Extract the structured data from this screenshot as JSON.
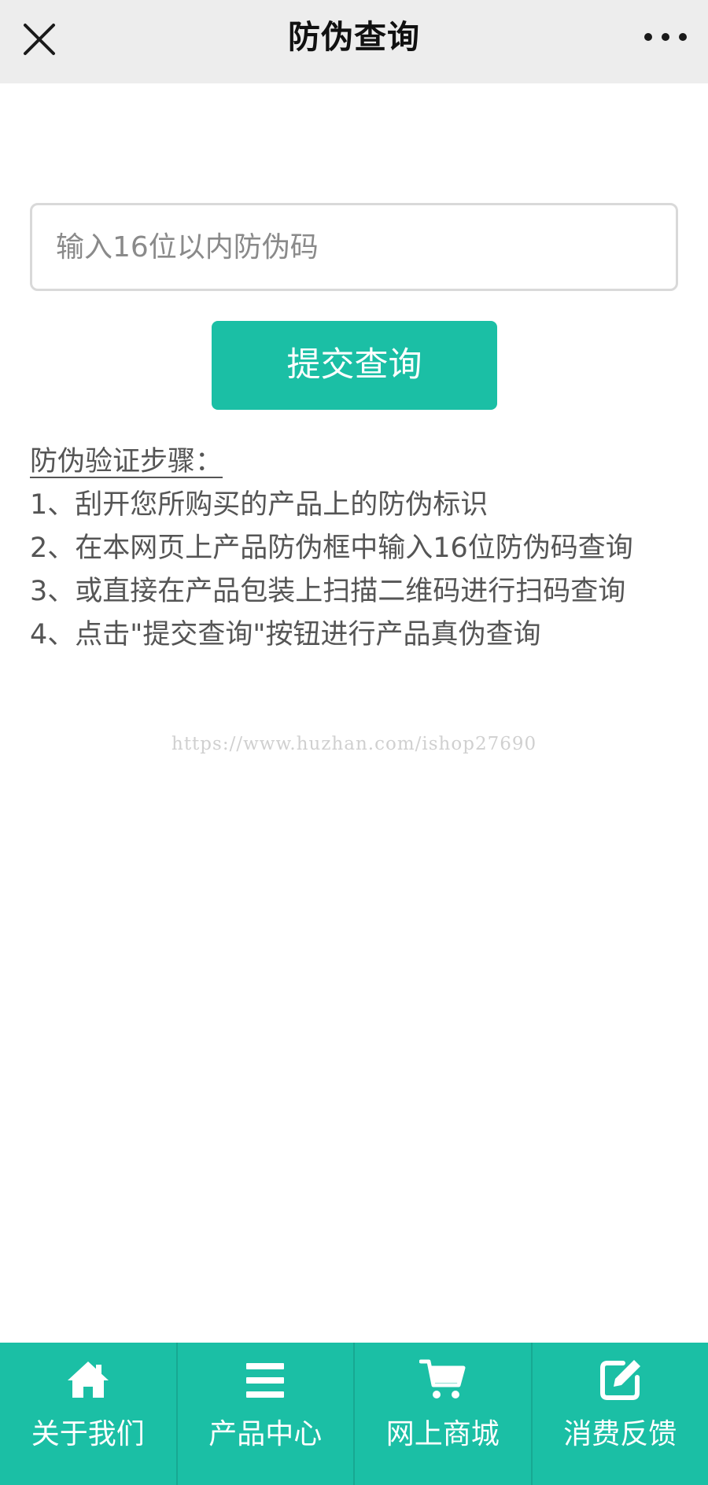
{
  "header": {
    "title": "防伪查询",
    "close_icon": "close-icon",
    "more_icon": "more-horizontal-icon"
  },
  "form": {
    "input_placeholder": "输入16位以内防伪码",
    "input_value": "",
    "submit_label": "提交查询"
  },
  "steps": {
    "title": "防伪验证步骤：",
    "items": [
      "1、刮开您所购买的产品上的防伪标识",
      "2、在本网页上产品防伪框中输入16位防伪码查询",
      "3、或直接在产品包装上扫描二维码进行扫码查询",
      "4、点击\"提交查询\"按钮进行产品真伪查询"
    ]
  },
  "watermark": "https://www.huzhan.com/ishop27690",
  "bottom_nav": {
    "items": [
      {
        "label": "关于我们",
        "icon": "home-icon"
      },
      {
        "label": "产品中心",
        "icon": "list-icon"
      },
      {
        "label": "网上商城",
        "icon": "cart-icon"
      },
      {
        "label": "消费反馈",
        "icon": "edit-icon"
      }
    ]
  },
  "colors": {
    "accent": "#1bbfa5",
    "header_bg": "#ededed",
    "text_gray": "#555555"
  }
}
